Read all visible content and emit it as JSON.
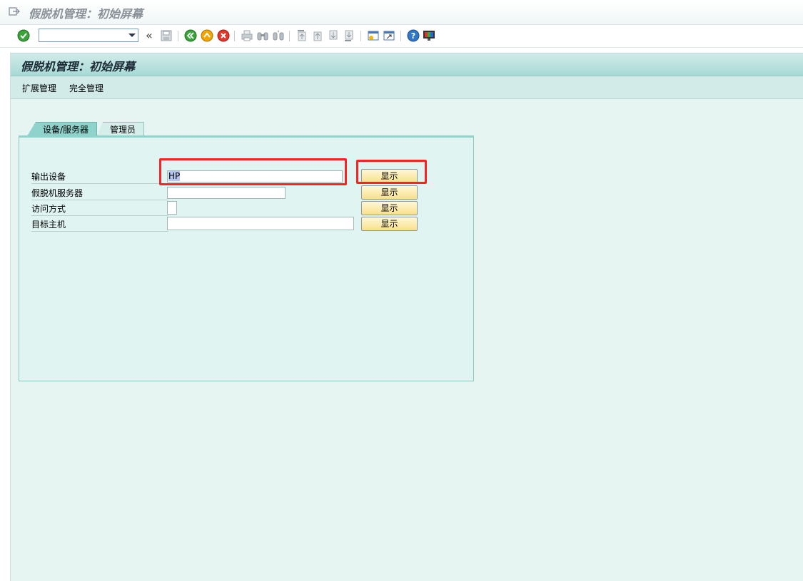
{
  "window": {
    "title": "假脱机管理：初始屏幕"
  },
  "toolbar": {
    "command_field": {
      "value": "",
      "placeholder": ""
    },
    "history_glyph": "«",
    "icons": [
      "enter-icon",
      "save-icon",
      "back-icon",
      "exit-icon",
      "cancel-icon",
      "print-icon",
      "find-icon",
      "find-next-icon",
      "first-page-icon",
      "previous-page-icon",
      "next-page-icon",
      "last-page-icon",
      "create-session-icon",
      "shortcut-icon",
      "help-icon",
      "customize-layout-icon"
    ]
  },
  "screen": {
    "title": "假脱机管理：初始屏幕",
    "appbar": {
      "extended_admin": "扩展管理",
      "full_admin": "完全管理"
    }
  },
  "tabs": [
    {
      "label": "设备/服务器",
      "active": true
    },
    {
      "label": "管理员",
      "active": false
    }
  ],
  "form": {
    "rows": [
      {
        "label": "输出设备",
        "value": "HP",
        "button": "显示"
      },
      {
        "label": "假脱机服务器",
        "value": "",
        "button": "显示"
      },
      {
        "label": "访问方式",
        "value": "",
        "button": "显示"
      },
      {
        "label": "目标主机",
        "value": "",
        "button": "显示"
      }
    ]
  },
  "highlight_color": "#ff2020"
}
